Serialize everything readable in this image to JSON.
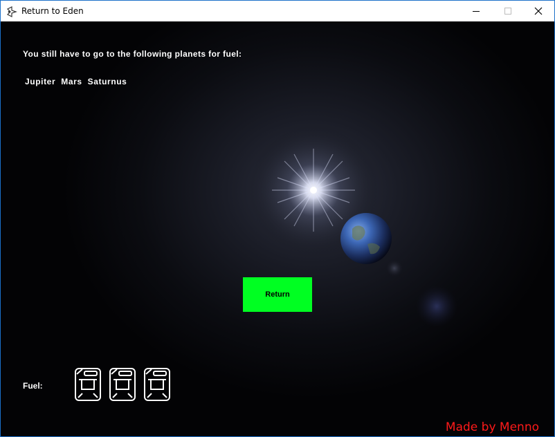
{
  "window": {
    "title": "Return to Eden",
    "app_icon": "game-app-icon",
    "controls": [
      "minimize",
      "maximize",
      "close"
    ]
  },
  "game": {
    "info_text": "You still have to go to the following planets for fuel:",
    "planets": [
      {
        "label": "Jupiter"
      },
      {
        "label": "Mars"
      },
      {
        "label": "Saturnus"
      }
    ],
    "return_button": "Return",
    "return_button_color": "#00ff22",
    "fuel_label": "Fuel:",
    "fuel_icon": "jerrycan-icon",
    "fuel_cans": 3,
    "credit": "Made by Menno",
    "credit_color": "#ff1a1a"
  }
}
